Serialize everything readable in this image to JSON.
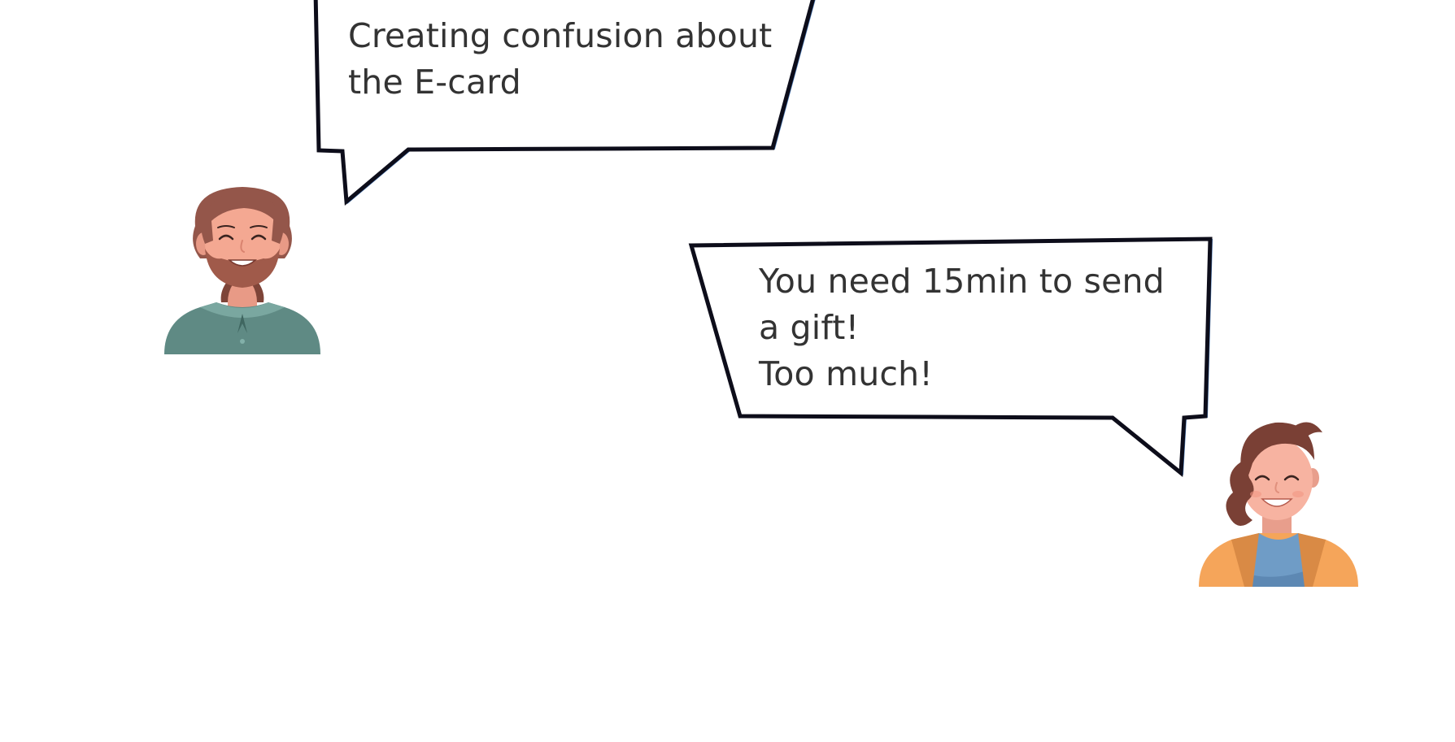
{
  "bubbles": [
    {
      "speaker": "man",
      "lines": [
        "Creating confusion about",
        "the E-card"
      ]
    },
    {
      "speaker": "woman",
      "lines": [
        "You need 15min to send",
        "a gift!",
        "Too much!"
      ]
    }
  ],
  "colors": {
    "bubble_outline": "#0d0d1a",
    "bubble_outline_accent": "#4a7ab8",
    "text": "#333333",
    "man_hair": "#94564a",
    "man_skin": "#f4a892",
    "man_shirt": "#5f8a84",
    "woman_hair": "#7a4035",
    "woman_skin": "#f7b3a1",
    "woman_jacket": "#f5a55a",
    "woman_shirt": "#6f9cc6"
  },
  "icons": {
    "man": "bearded-man-avatar-icon",
    "woman": "woman-avatar-icon"
  }
}
